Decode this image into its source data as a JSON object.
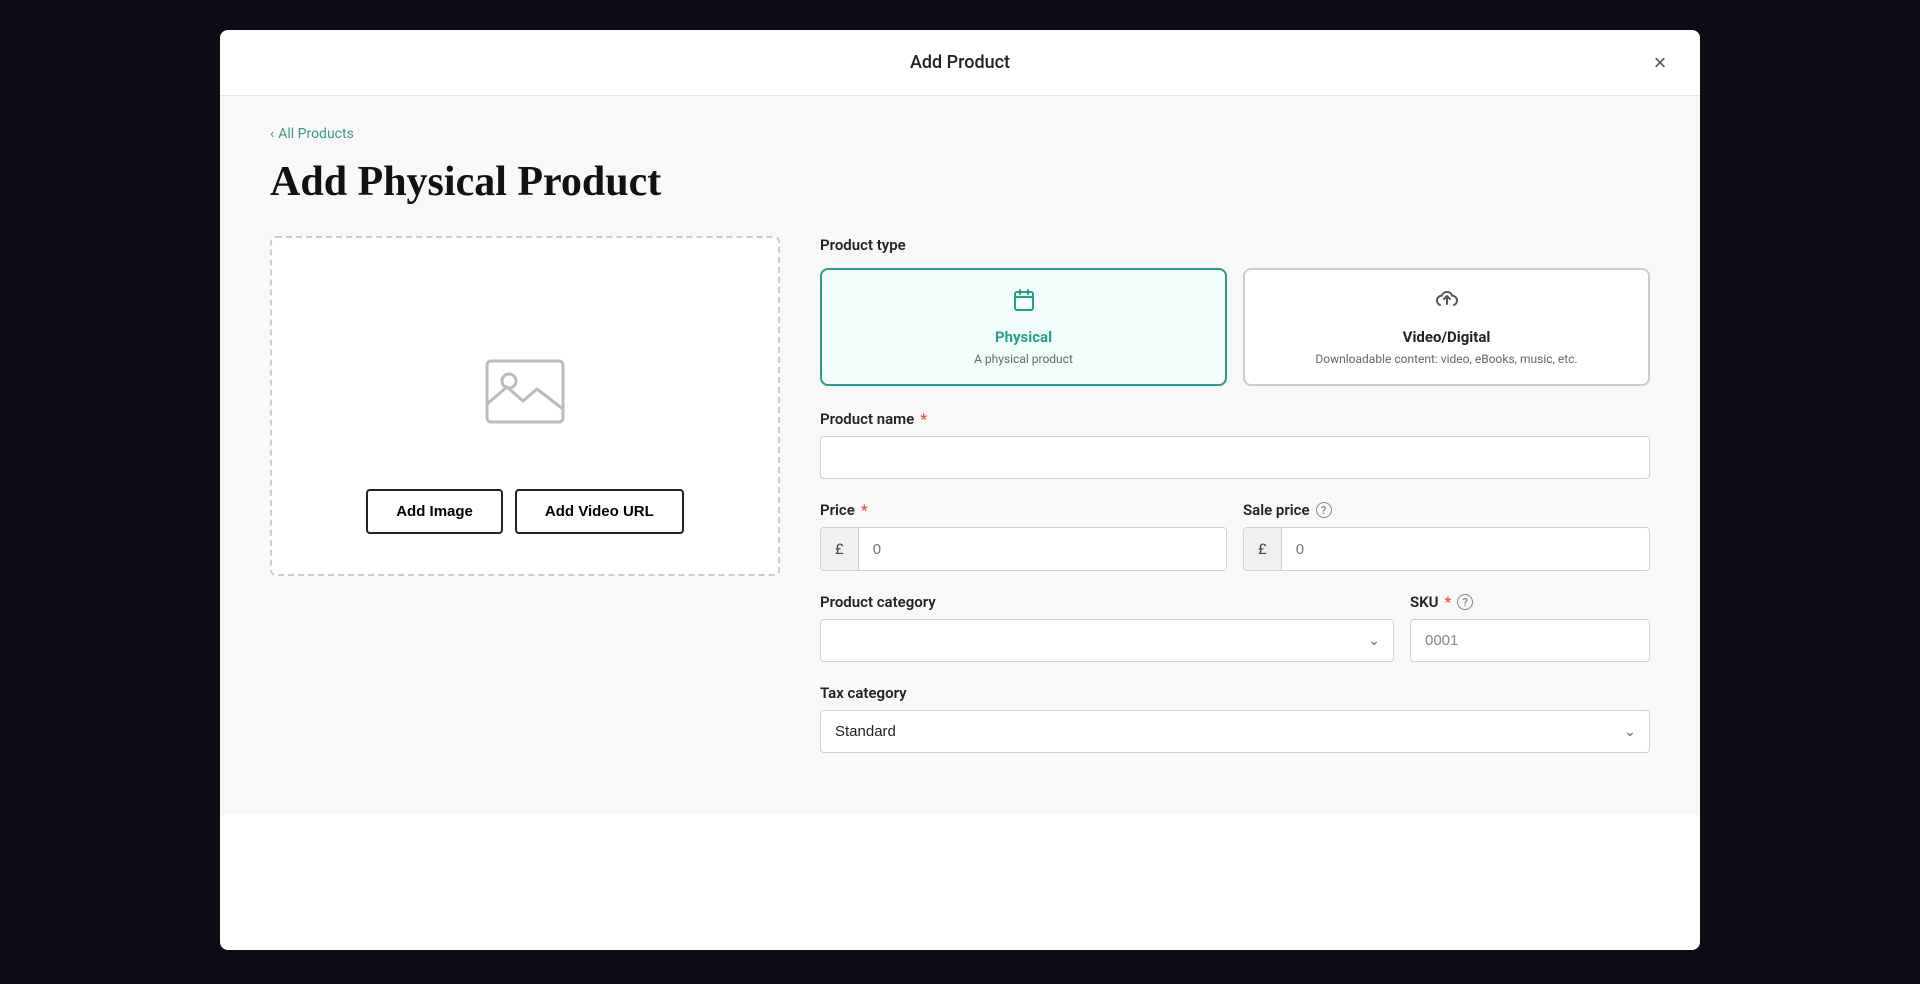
{
  "modal": {
    "title": "Add Product",
    "close_label": "×"
  },
  "breadcrumb": {
    "arrow": "‹",
    "label": "All Products"
  },
  "page_title": "Add Physical Product",
  "image_upload": {
    "add_image_label": "Add Image",
    "add_video_url_label": "Add Video URL"
  },
  "product_type": {
    "label": "Product type",
    "options": [
      {
        "id": "physical",
        "title": "Physical",
        "subtitle": "A physical product",
        "selected": true
      },
      {
        "id": "video_digital",
        "title": "Video/Digital",
        "subtitle": "Downloadable content: video, eBooks, music, etc.",
        "selected": false
      }
    ]
  },
  "product_name": {
    "label": "Product name",
    "required": true,
    "placeholder": "",
    "value": ""
  },
  "price": {
    "label": "Price",
    "required": true,
    "currency_symbol": "£",
    "placeholder": "0",
    "value": ""
  },
  "sale_price": {
    "label": "Sale price",
    "currency_symbol": "£",
    "placeholder": "0",
    "value": ""
  },
  "product_category": {
    "label": "Product category",
    "placeholder": "",
    "options": []
  },
  "sku": {
    "label": "SKU",
    "required": true,
    "value": "0001",
    "placeholder": "0001"
  },
  "tax_category": {
    "label": "Tax category",
    "placeholder": "Standard",
    "options": [
      "Standard"
    ]
  },
  "icons": {
    "physical_icon": "📅",
    "digital_icon": "☁",
    "image_placeholder": "🖼"
  },
  "colors": {
    "teal": "#2a9d8f",
    "required_red": "#e74c3c"
  }
}
